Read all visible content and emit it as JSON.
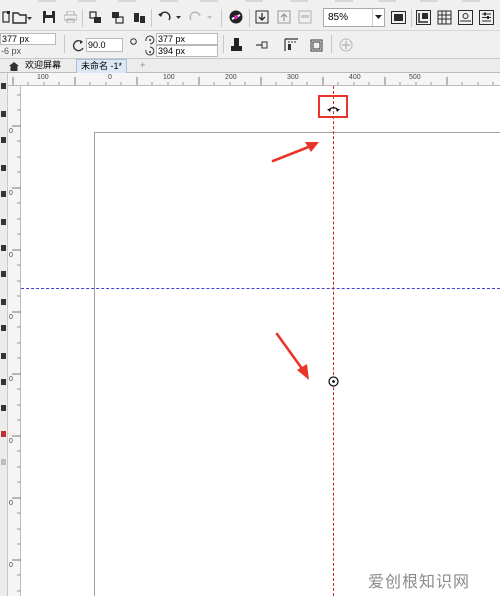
{
  "toolbar": {
    "zoom_value": "85%"
  },
  "property_bar": {
    "position_x": "377 px",
    "position_y": "-6 px",
    "rotation_angle": "90.0",
    "center_x": "377 px",
    "center_y": "394 px"
  },
  "tabs": [
    {
      "label": "欢迎屏幕"
    },
    {
      "label": "未命名 -1*"
    },
    {
      "label": "+"
    }
  ],
  "rulers": {
    "horizontal_labels": [
      "100",
      "0",
      "100",
      "200",
      "300",
      "400",
      "500"
    ],
    "vertical_labels": [
      "0",
      "0",
      "0",
      "0",
      "0",
      "0",
      "0",
      "0"
    ]
  },
  "colors": {
    "guide_vertical": "#d62020",
    "guide_horizontal": "#4040d8",
    "highlight": "#e8352a",
    "active_tab": "#dde8f5"
  },
  "icons": [
    "new-icon",
    "open-icon",
    "save-icon",
    "print-icon",
    "import-icon",
    "export-icon",
    "undo-icon",
    "redo-icon",
    "corel-connect-icon",
    "zoom-fit-icon",
    "snap-icon",
    "options-icon",
    "home-icon",
    "lock-icon",
    "rotation-marker-icon",
    "center-marker-icon"
  ],
  "watermark": "爱创根知识网"
}
